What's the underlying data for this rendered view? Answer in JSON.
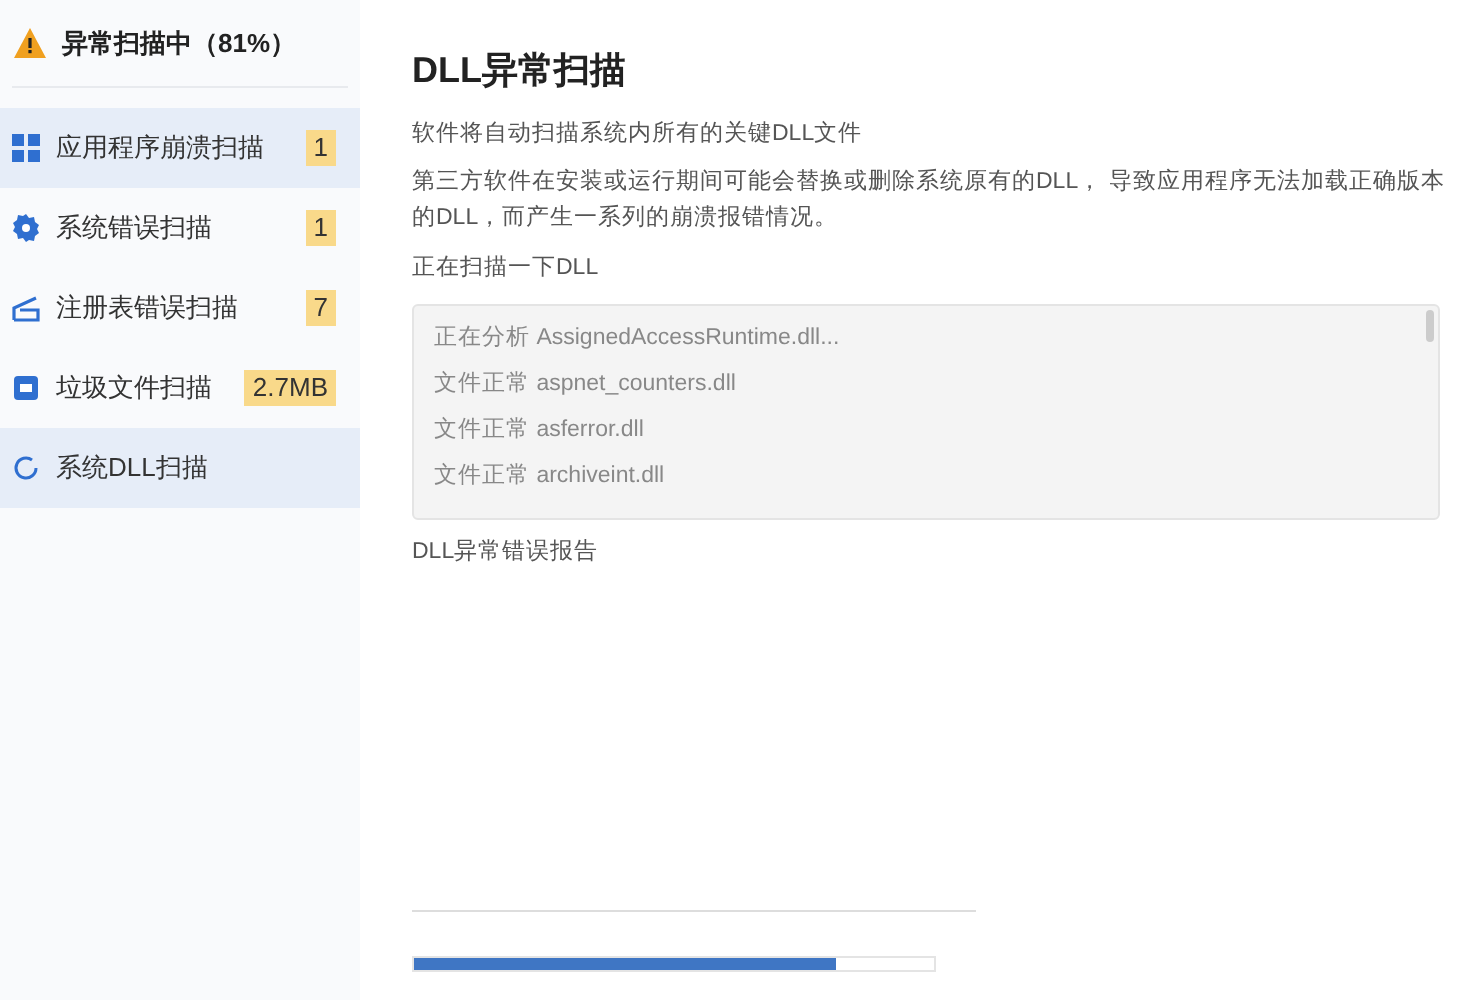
{
  "sidebar": {
    "status": {
      "title": "异常扫描中（81%）"
    },
    "items": [
      {
        "kind": "grid",
        "label": "应用程序崩溃扫描",
        "badge": "1",
        "selected": true
      },
      {
        "kind": "gear",
        "label": "系统错误扫描",
        "badge": "1",
        "selected": false
      },
      {
        "kind": "registry",
        "label": "注册表错误扫描",
        "badge": "7",
        "selected": false
      },
      {
        "kind": "junk",
        "label": "垃圾文件扫描",
        "badge": "2.7MB",
        "selected": false
      },
      {
        "kind": "spinner",
        "label": "系统DLL扫描",
        "selected": true
      }
    ]
  },
  "main": {
    "title": "DLL异常扫描",
    "description": [
      "软件将自动扫描系统内所有的关键DLL文件",
      "第三方软件在安装或运行期间可能会替换或删除系统原有的DLL， 导致应用程序无法加载正确版本的DLL，而产生一系列的崩溃报错情况。"
    ],
    "log_label": "正在扫描一下DLL",
    "log": [
      "正在分析 AssignedAccessRuntime.dll...",
      "文件正常 aspnet_counters.dll",
      "文件正常 asferror.dll",
      "文件正常 archiveint.dll"
    ],
    "report_label": "DLL异常错误报告",
    "progress": {
      "level": 0.81
    }
  }
}
